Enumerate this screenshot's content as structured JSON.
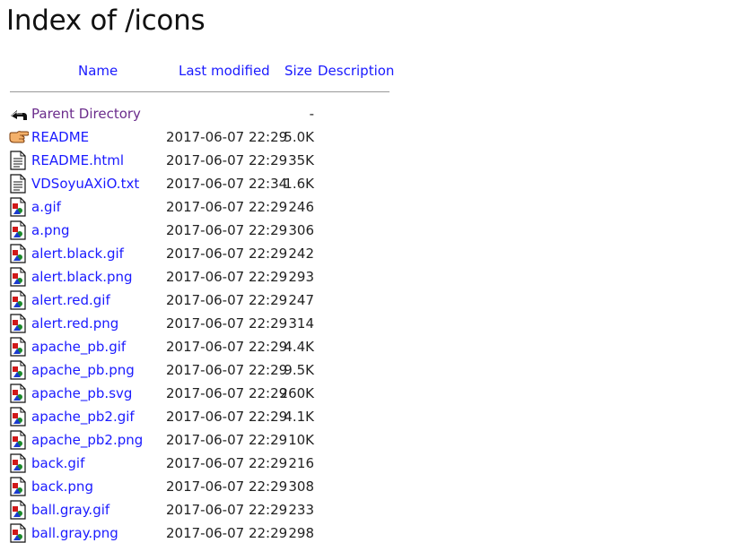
{
  "title": "Index of /icons",
  "columns": {
    "name": "Name",
    "last_modified": "Last modified",
    "size": "Size",
    "description": "Description"
  },
  "rows": [
    {
      "name": "Parent Directory",
      "modified": "",
      "size": "-",
      "icon": "back-icon"
    },
    {
      "name": "README",
      "modified": "2017-06-07 22:29",
      "size": "5.0K",
      "icon": "hand-right-icon"
    },
    {
      "name": "README.html",
      "modified": "2017-06-07 22:29",
      "size": "35K",
      "icon": "text-file-icon"
    },
    {
      "name": "VDSoyuAXiO.txt",
      "modified": "2017-06-07 22:34",
      "size": "1.6K",
      "icon": "text-file-icon"
    },
    {
      "name": "a.gif",
      "modified": "2017-06-07 22:29",
      "size": "246",
      "icon": "image-file-icon"
    },
    {
      "name": "a.png",
      "modified": "2017-06-07 22:29",
      "size": "306",
      "icon": "image-file-icon"
    },
    {
      "name": "alert.black.gif",
      "modified": "2017-06-07 22:29",
      "size": "242",
      "icon": "image-file-icon"
    },
    {
      "name": "alert.black.png",
      "modified": "2017-06-07 22:29",
      "size": "293",
      "icon": "image-file-icon"
    },
    {
      "name": "alert.red.gif",
      "modified": "2017-06-07 22:29",
      "size": "247",
      "icon": "image-file-icon"
    },
    {
      "name": "alert.red.png",
      "modified": "2017-06-07 22:29",
      "size": "314",
      "icon": "image-file-icon"
    },
    {
      "name": "apache_pb.gif",
      "modified": "2017-06-07 22:29",
      "size": "4.4K",
      "icon": "image-file-icon"
    },
    {
      "name": "apache_pb.png",
      "modified": "2017-06-07 22:29",
      "size": "9.5K",
      "icon": "image-file-icon"
    },
    {
      "name": "apache_pb.svg",
      "modified": "2017-06-07 22:29",
      "size": "260K",
      "icon": "image-file-icon"
    },
    {
      "name": "apache_pb2.gif",
      "modified": "2017-06-07 22:29",
      "size": "4.1K",
      "icon": "image-file-icon"
    },
    {
      "name": "apache_pb2.png",
      "modified": "2017-06-07 22:29",
      "size": "10K",
      "icon": "image-file-icon"
    },
    {
      "name": "back.gif",
      "modified": "2017-06-07 22:29",
      "size": "216",
      "icon": "image-file-icon"
    },
    {
      "name": "back.png",
      "modified": "2017-06-07 22:29",
      "size": "308",
      "icon": "image-file-icon"
    },
    {
      "name": "ball.gray.gif",
      "modified": "2017-06-07 22:29",
      "size": "233",
      "icon": "image-file-icon"
    },
    {
      "name": "ball.gray.png",
      "modified": "2017-06-07 22:29",
      "size": "298",
      "icon": "image-file-icon"
    }
  ],
  "colors": {
    "link": "#1a1aff",
    "visited_link": "#6b2c8c",
    "text": "#222222"
  }
}
